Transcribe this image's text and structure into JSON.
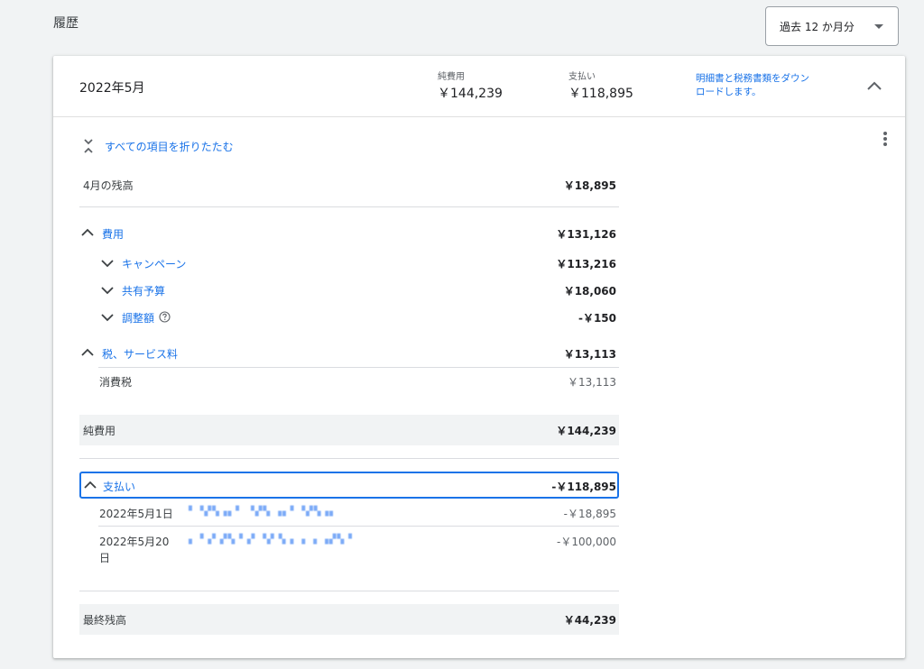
{
  "page": {
    "title": "履歴"
  },
  "range_select": {
    "value": "過去 12 か月分"
  },
  "card": {
    "period": "2022年5月",
    "net_cost_label": "純費用",
    "net_cost_value": "￥144,239",
    "payment_label": "支払い",
    "payment_value": "￥118,895",
    "download_link": "明細書と税務書類をダウンロードします。"
  },
  "ledger": {
    "collapse_all": "すべての項目を折りたたむ",
    "opening_label": "4月の残高",
    "opening_value": "￥18,895",
    "costs_label": "費用",
    "costs_value": "￥131,126",
    "campaign_label": "キャンペーン",
    "campaign_value": "￥113,216",
    "shared_budget_label": "共有予算",
    "shared_budget_value": "￥18,060",
    "adjustments_label": "調整額",
    "adjustments_value": "-￥150",
    "tax_label": "税、サービス料",
    "tax_value": "￥13,113",
    "consumption_tax_label": "消費税",
    "consumption_tax_value": "￥13,113",
    "net_cost_label": "純費用",
    "net_cost_value": "￥144,239",
    "payments_label": "支払い",
    "payments_value": "-￥118,895",
    "payments": [
      {
        "date": "2022年5月1日",
        "desc": "▘▝▞▚▗▖▘ ▝▞▚ ▗▖▘▝▞▚▗▖",
        "amount": "-￥18,895"
      },
      {
        "date_line1": "2022年5月20",
        "date_line2": "日",
        "desc": "▖▝▗▘▞▚▝▗▘▝▞ ▚▗ ▗ ▗ ▗▞▚▝",
        "amount": "-￥100,000"
      }
    ],
    "closing_label": "最終残高",
    "closing_value": "￥44,239"
  },
  "icons": {
    "range_caret": "caret-down-icon",
    "header_toggle": "chevron-up-icon",
    "more": "more-vert-icon",
    "collapse_all": "unfold-less-icon",
    "help": "help-circle-icon"
  },
  "colors": {
    "accent": "#1a73e8",
    "background": "#f1f3f4"
  }
}
